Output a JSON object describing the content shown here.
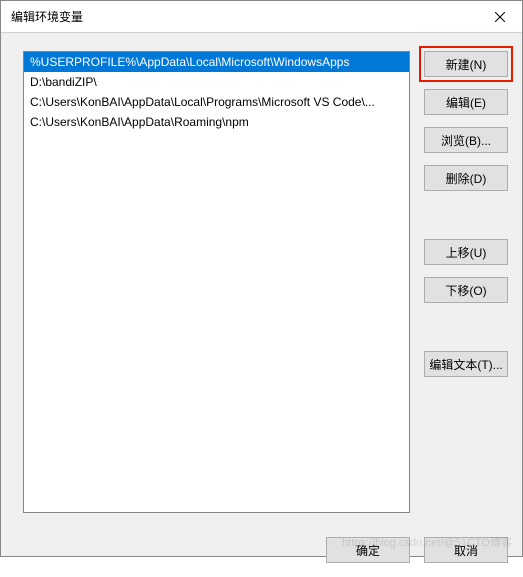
{
  "window": {
    "title": "编辑环境变量"
  },
  "list": {
    "items": [
      "%USERPROFILE%\\AppData\\Local\\Microsoft\\WindowsApps",
      "D:\\bandiZIP\\",
      "C:\\Users\\KonBAI\\AppData\\Local\\Programs\\Microsoft VS Code\\...",
      "C:\\Users\\KonBAI\\AppData\\Roaming\\npm"
    ],
    "selected_index": 0
  },
  "buttons": {
    "new": "新建(N)",
    "edit": "编辑(E)",
    "browse": "浏览(B)...",
    "delete": "删除(D)",
    "move_up": "上移(U)",
    "move_down": "下移(O)",
    "edit_text": "编辑文本(T)...",
    "ok": "确定",
    "cancel": "取消"
  },
  "watermark": "https://blog.csdn.net/@51CTO博客"
}
